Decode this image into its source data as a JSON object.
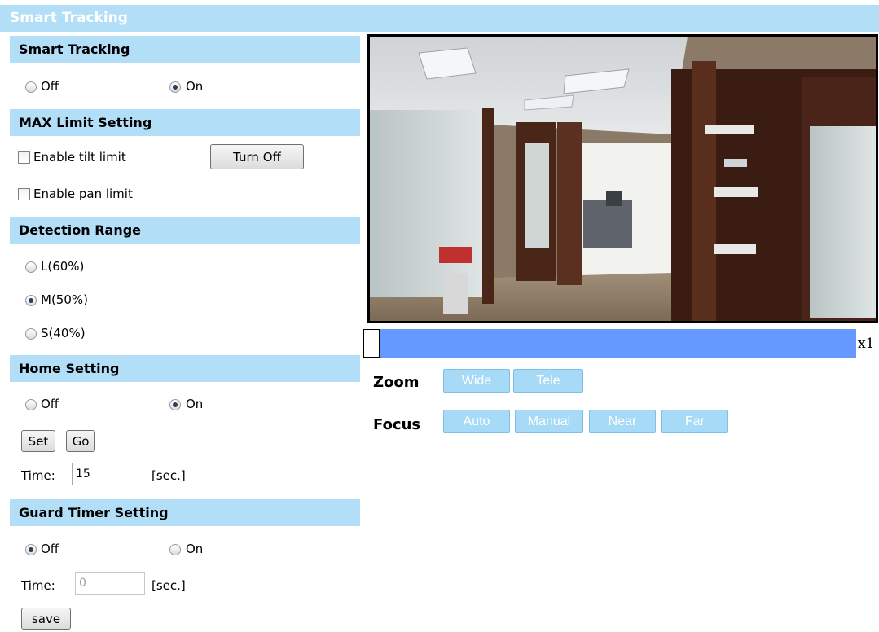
{
  "window": {
    "title": "Smart Tracking"
  },
  "smart_tracking": {
    "header": "Smart Tracking",
    "off_label": "Off",
    "on_label": "On",
    "selected": "On"
  },
  "max_limit": {
    "header": "MAX Limit Setting",
    "tilt_label": "Enable tilt limit",
    "pan_label": "Enable pan limit",
    "tilt_checked": false,
    "pan_checked": false,
    "turn_off_label": "Turn Off"
  },
  "detection_range": {
    "header": "Detection Range",
    "options": [
      "L(60%)",
      "M(50%)",
      "S(40%)"
    ],
    "selected": "M(50%)"
  },
  "home_setting": {
    "header": "Home Setting",
    "off_label": "Off",
    "on_label": "On",
    "selected": "On",
    "set_label": "Set",
    "go_label": "Go",
    "time_label": "Time:",
    "time_value": "15",
    "unit_label": "[sec.]"
  },
  "guard_timer": {
    "header": "Guard Timer Setting",
    "off_label": "Off",
    "on_label": "On",
    "selected": "Off",
    "time_label": "Time:",
    "time_value": "0",
    "unit_label": "[sec.]",
    "save_label": "save"
  },
  "camera": {
    "zoom_value": "x1",
    "zoom_fraction": 0.0
  },
  "controls": {
    "zoom_label": "Zoom",
    "wide_label": "Wide",
    "tele_label": "Tele",
    "focus_label": "Focus",
    "auto_label": "Auto",
    "manual_label": "Manual",
    "near_label": "Near",
    "far_label": "Far"
  },
  "colors": {
    "section_header_bg": "#b2def8",
    "zoom_bar": "#6699ff",
    "control_button_bg": "#a6daf6"
  }
}
